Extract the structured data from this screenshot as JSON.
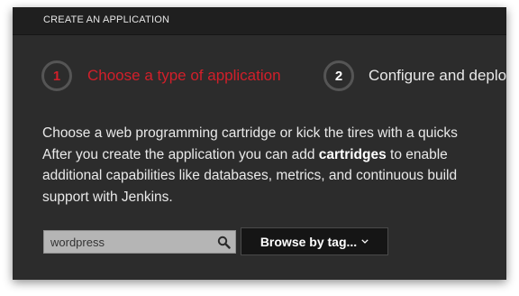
{
  "header": {
    "title": "CREATE AN APPLICATION"
  },
  "steps": [
    {
      "number": "1",
      "label": "Choose a type of application",
      "state": "active",
      "color": "#d21f2a"
    },
    {
      "number": "2",
      "label": "Configure and deplo",
      "state": "inactive"
    }
  ],
  "description": {
    "line1": "Choose a web programming cartridge or kick the tires with a quicks",
    "line2_before": "After you create the application you can add ",
    "line2_bold": "cartridges",
    "line2_after": " to enable",
    "line3": "additional capabilities like databases, metrics, and continuous build",
    "line4": "support with Jenkins."
  },
  "search": {
    "value": "wordpress",
    "icon": "search-icon"
  },
  "browse": {
    "label": "Browse by tag...",
    "icon": "chevron-down-icon"
  },
  "colors": {
    "background": "#2c2c2c",
    "header_background": "#1f1f1f",
    "accent": "#d21f2a"
  }
}
